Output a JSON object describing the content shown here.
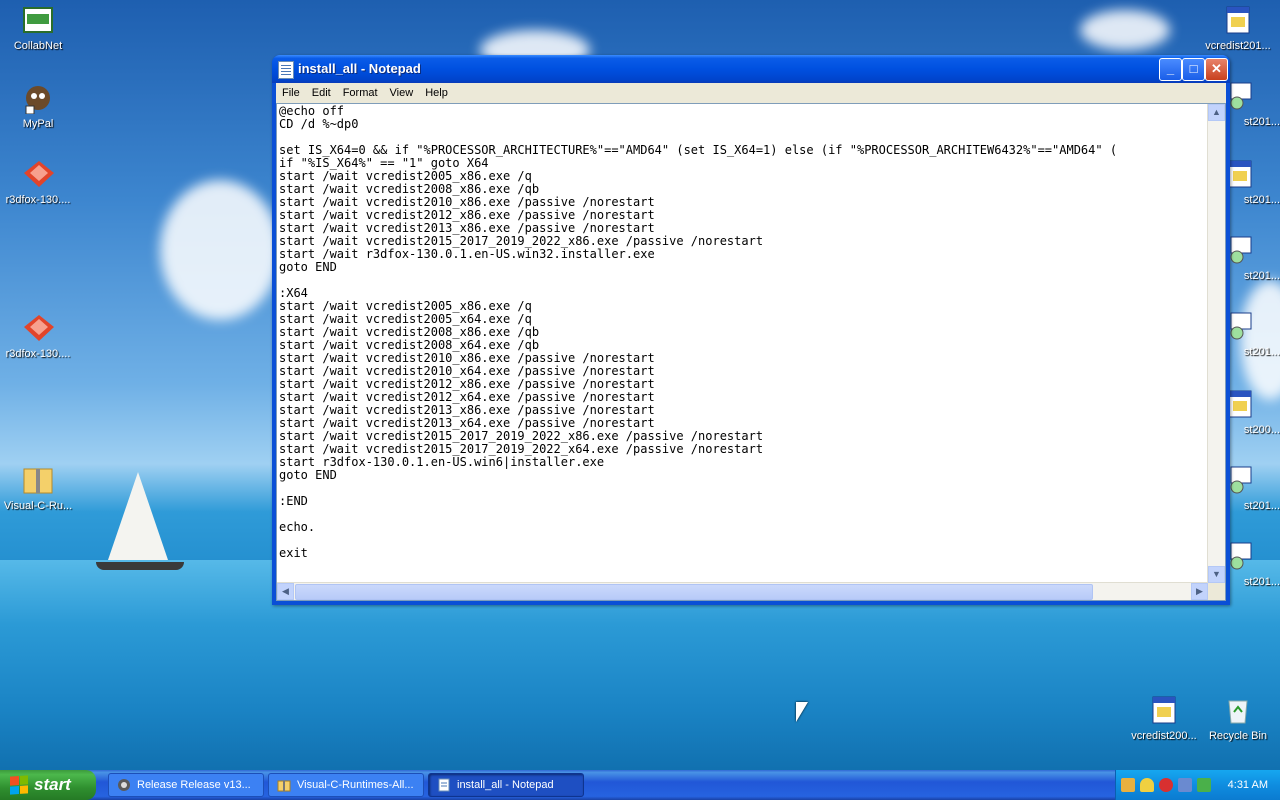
{
  "desktop": {
    "left_icons": [
      {
        "label": "CollabNet",
        "icon": "collabnet-icon"
      },
      {
        "label": "MyPal",
        "icon": "mypal-icon"
      },
      {
        "label": "r3dfox-130....",
        "icon": "r3dfox-icon"
      },
      {
        "label": "r3dfox-130....",
        "icon": "r3dfox-icon"
      },
      {
        "label": "Visual-C-Ru...",
        "icon": "zip-folder-icon"
      }
    ],
    "right_icons": [
      {
        "label": "vcredist201...",
        "icon": "installer-icon"
      },
      {
        "label": "st201...",
        "icon": "installer-cd-icon"
      },
      {
        "label": "st201...",
        "icon": "installer-icon"
      },
      {
        "label": "st201...",
        "icon": "installer-cd-icon"
      },
      {
        "label": "st201...",
        "icon": "installer-cd-icon"
      },
      {
        "label": "st200...",
        "icon": "installer-icon"
      },
      {
        "label": "st201...",
        "icon": "installer-cd-icon"
      },
      {
        "label": "st201...",
        "icon": "installer-cd-icon"
      }
    ],
    "bottom_icons": [
      {
        "label": "vcredist200...",
        "icon": "installer-icon"
      },
      {
        "label": "Recycle Bin",
        "icon": "recycle-bin-icon"
      }
    ]
  },
  "window": {
    "title": "install_all - Notepad",
    "min": "_",
    "max": "□",
    "close": "✕",
    "menu": [
      "File",
      "Edit",
      "Format",
      "View",
      "Help"
    ],
    "content": "@echo off\nCD /d %~dp0\n\nset IS_X64=0 && if \"%PROCESSOR_ARCHITECTURE%\"==\"AMD64\" (set IS_X64=1) else (if \"%PROCESSOR_ARCHITEW6432%\"==\"AMD64\" (\nif \"%IS_X64%\" == \"1\" goto X64\nstart /wait vcredist2005_x86.exe /q\nstart /wait vcredist2008_x86.exe /qb\nstart /wait vcredist2010_x86.exe /passive /norestart\nstart /wait vcredist2012_x86.exe /passive /norestart\nstart /wait vcredist2013_x86.exe /passive /norestart\nstart /wait vcredist2015_2017_2019_2022_x86.exe /passive /norestart\nstart /wait r3dfox-130.0.1.en-US.win32.installer.exe\ngoto END\n\n:X64\nstart /wait vcredist2005_x86.exe /q\nstart /wait vcredist2005_x64.exe /q\nstart /wait vcredist2008_x86.exe /qb\nstart /wait vcredist2008_x64.exe /qb\nstart /wait vcredist2010_x86.exe /passive /norestart\nstart /wait vcredist2010_x64.exe /passive /norestart\nstart /wait vcredist2012_x86.exe /passive /norestart\nstart /wait vcredist2012_x64.exe /passive /norestart\nstart /wait vcredist2013_x86.exe /passive /norestart\nstart /wait vcredist2013_x64.exe /passive /norestart\nstart /wait vcredist2015_2017_2019_2022_x86.exe /passive /norestart\nstart /wait vcredist2015_2017_2019_2022_x64.exe /passive /norestart\nstart r3dfox-130.0.1.en-US.win6|installer.exe\ngoto END\n\n:END\n\necho.\n\nexit"
  },
  "taskbar": {
    "start_label": "start",
    "tasks": [
      {
        "label": "Release Release v13...",
        "icon": "browser-icon",
        "active": false
      },
      {
        "label": "Visual-C-Runtimes-All...",
        "icon": "folder-icon",
        "active": false
      },
      {
        "label": "install_all - Notepad",
        "icon": "notepad-icon",
        "active": true
      }
    ],
    "clock": "4:31 AM"
  }
}
